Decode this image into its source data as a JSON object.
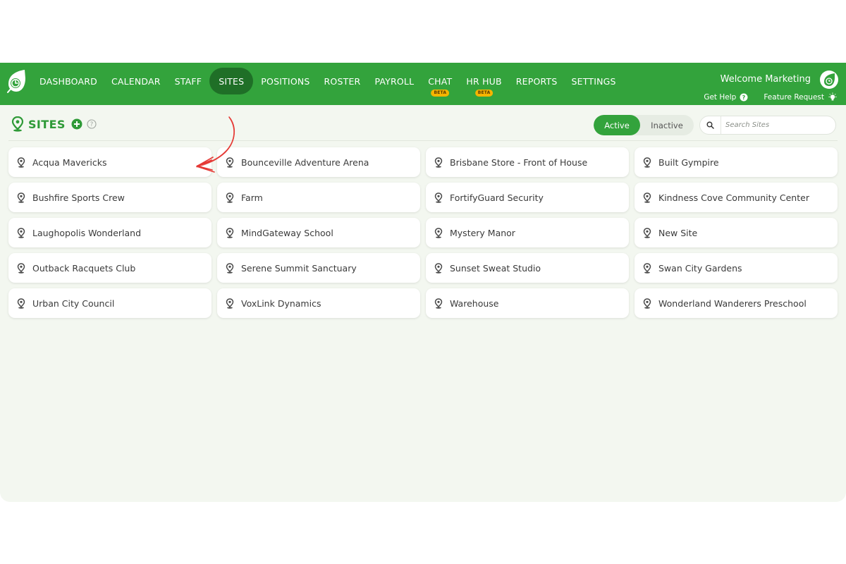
{
  "nav": {
    "items": [
      {
        "label": "DASHBOARD"
      },
      {
        "label": "CALENDAR"
      },
      {
        "label": "STAFF"
      },
      {
        "label": "SITES"
      },
      {
        "label": "POSITIONS"
      },
      {
        "label": "ROSTER"
      },
      {
        "label": "PAYROLL"
      },
      {
        "label": "CHAT",
        "badge": "BETA"
      },
      {
        "label": "HR HUB",
        "badge": "BETA"
      },
      {
        "label": "REPORTS"
      },
      {
        "label": "SETTINGS"
      }
    ],
    "active": "SITES",
    "welcome": "Welcome Marketing",
    "help": "Get Help",
    "feature_request": "Feature Request"
  },
  "page": {
    "title": "SITES",
    "filter": {
      "active_label": "Active",
      "inactive_label": "Inactive",
      "selected": "Active"
    },
    "search_placeholder": "Search Sites"
  },
  "sites": [
    "Acqua Mavericks",
    "Bounceville Adventure Arena",
    "Brisbane Store - Front of House",
    "Built Gympire",
    "Bushfire Sports Crew",
    "Farm",
    "FortifyGuard Security",
    "Kindness Cove Community Center",
    "Laughopolis Wonderland",
    "MindGateway School",
    "Mystery Manor",
    "New Site",
    "Outback Racquets Club",
    "Serene Summit Sanctuary",
    "Sunset Sweat Studio",
    "Swan City Gardens",
    "Urban City Council",
    "VoxLink Dynamics",
    "Warehouse",
    "Wonderland Wanderers Preschool"
  ],
  "colors": {
    "brand": "#33a33c",
    "active_nav": "#1f6f27",
    "badge": "#f5b400",
    "annotation": "#e53935"
  }
}
